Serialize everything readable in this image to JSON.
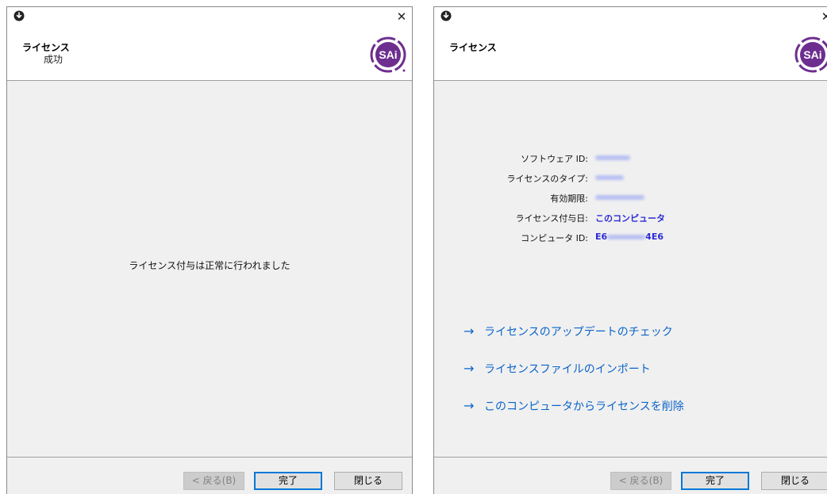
{
  "dialog_success": {
    "header": {
      "title": "ライセンス",
      "subtitle": "成功"
    },
    "message": "ライセンス付与は正常に行われました",
    "buttons": {
      "back": "< 戻る(B)",
      "finish": "完了",
      "close": "閉じる"
    }
  },
  "dialog_info": {
    "header": {
      "title": "ライセンス"
    },
    "info": {
      "software_id_label": "ソフトウェア ID:",
      "license_type_label": "ライセンスのタイプ:",
      "expiry_label": "有効期限:",
      "licensed_to_label": "ライセンス付与日:",
      "licensed_to_value": "このコンピュータ",
      "computer_id_label": "コンピュータ ID:",
      "computer_id_prefix": "E6",
      "computer_id_suffix": "4E6"
    },
    "links": {
      "check_update": "ライセンスのアップデートのチェック",
      "import_file": "ライセンスファイルのインポート",
      "remove_license": "このコンピュータからライセンスを削除"
    },
    "buttons": {
      "back": "< 戻る(B)",
      "finish": "完了",
      "close": "閉じる"
    }
  },
  "logo_text": "SAi",
  "colors": {
    "link": "#0a64c8",
    "value": "#2b2bd6",
    "logo": "#6d2e8f",
    "default_button_border": "#0078d7"
  }
}
